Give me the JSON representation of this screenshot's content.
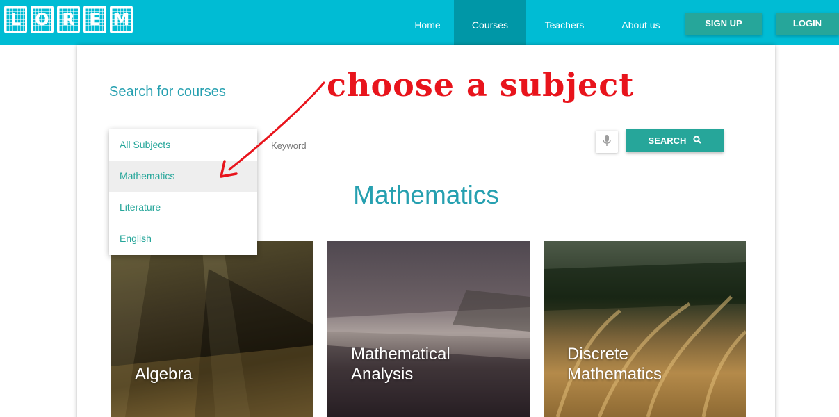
{
  "logo": {
    "text": "LOREM",
    "letters": [
      "L",
      "O",
      "R",
      "E",
      "M"
    ]
  },
  "nav": {
    "items": [
      {
        "label": "Home"
      },
      {
        "label": "Courses"
      },
      {
        "label": "Teachers"
      },
      {
        "label": "About us"
      }
    ],
    "signup_label": "SIGN UP",
    "login_label": "LOGIN"
  },
  "colors": {
    "navbar": "#00bcd4",
    "nav_active": "#0097a7",
    "accent": "#26a69a",
    "title_teal": "#26a0b0",
    "annotation": "#e8141c"
  },
  "search": {
    "title": "Search for courses",
    "keyword_placeholder": "Keyword",
    "button_label": "SEARCH",
    "mic_icon": "microphone-icon",
    "search_icon": "search-icon"
  },
  "subject_dropdown": {
    "options": [
      "All Subjects",
      "Mathematics",
      "Literature",
      "English"
    ],
    "highlighted": "Mathematics"
  },
  "section_title": "Mathematics",
  "courses": [
    {
      "title_line1": "Algebra",
      "title_line2": ""
    },
    {
      "title_line1": "Mathematical",
      "title_line2": "Analysis"
    },
    {
      "title_line1": "Discrete",
      "title_line2": "Mathematics"
    }
  ],
  "annotation": {
    "text": "choose a subject"
  }
}
